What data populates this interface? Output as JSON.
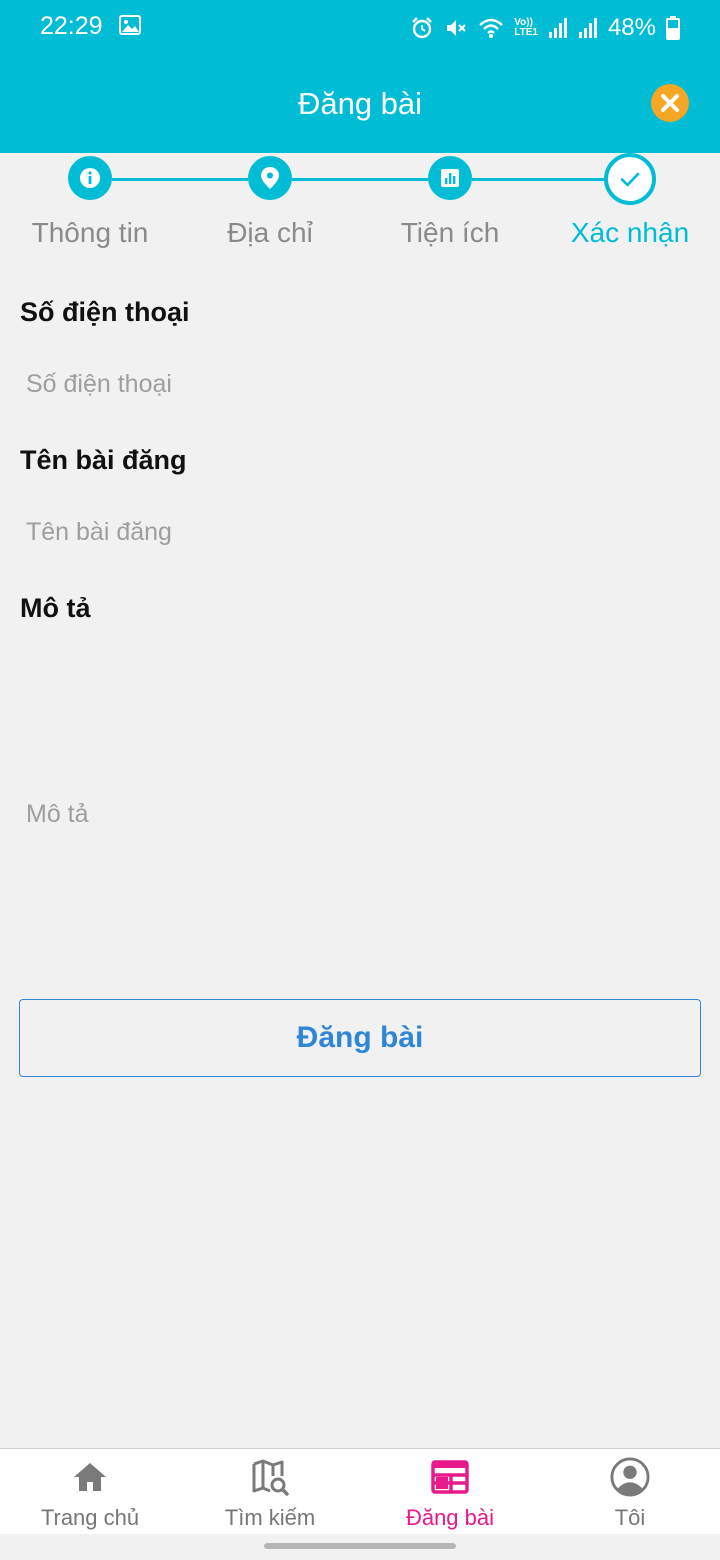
{
  "status_bar": {
    "time": "22:29",
    "battery": "48%",
    "lte_label": "Vo))\nLTE1",
    "icons": [
      "gallery-icon",
      "alarm-icon",
      "mute-icon",
      "wifi-icon",
      "lte-icon",
      "signal-icon",
      "signal-icon",
      "battery-icon"
    ]
  },
  "app_bar": {
    "title": "Đăng bài",
    "close_icon": "close-icon"
  },
  "stepper": {
    "steps": [
      {
        "label": "Thông tin",
        "icon": "info-icon",
        "state": "done"
      },
      {
        "label": "Địa chỉ",
        "icon": "location-pin-icon",
        "state": "done"
      },
      {
        "label": "Tiện ích",
        "icon": "chart-icon",
        "state": "done"
      },
      {
        "label": "Xác nhận",
        "icon": "check-icon",
        "state": "active"
      }
    ]
  },
  "form": {
    "phone": {
      "label": "Số điện thoại",
      "placeholder": "Số điện thoại",
      "value": ""
    },
    "title": {
      "label": "Tên bài đăng",
      "placeholder": "Tên bài đăng",
      "value": ""
    },
    "description": {
      "label": "Mô tả",
      "placeholder": "Mô tả",
      "value": ""
    },
    "submit_label": "Đăng bài"
  },
  "bottom_nav": {
    "items": [
      {
        "label": "Trang chủ",
        "icon": "home-icon",
        "active": false
      },
      {
        "label": "Tìm kiếm",
        "icon": "map-search-icon",
        "active": false
      },
      {
        "label": "Đăng bài",
        "icon": "post-icon",
        "active": true
      },
      {
        "label": "Tôi",
        "icon": "account-icon",
        "active": false
      }
    ]
  },
  "colors": {
    "primary": "#00bcd4",
    "close_button": "#f5a623",
    "submit_accent": "#2f86d6",
    "nav_active": "#e8198b",
    "background": "#f1f1f1"
  }
}
